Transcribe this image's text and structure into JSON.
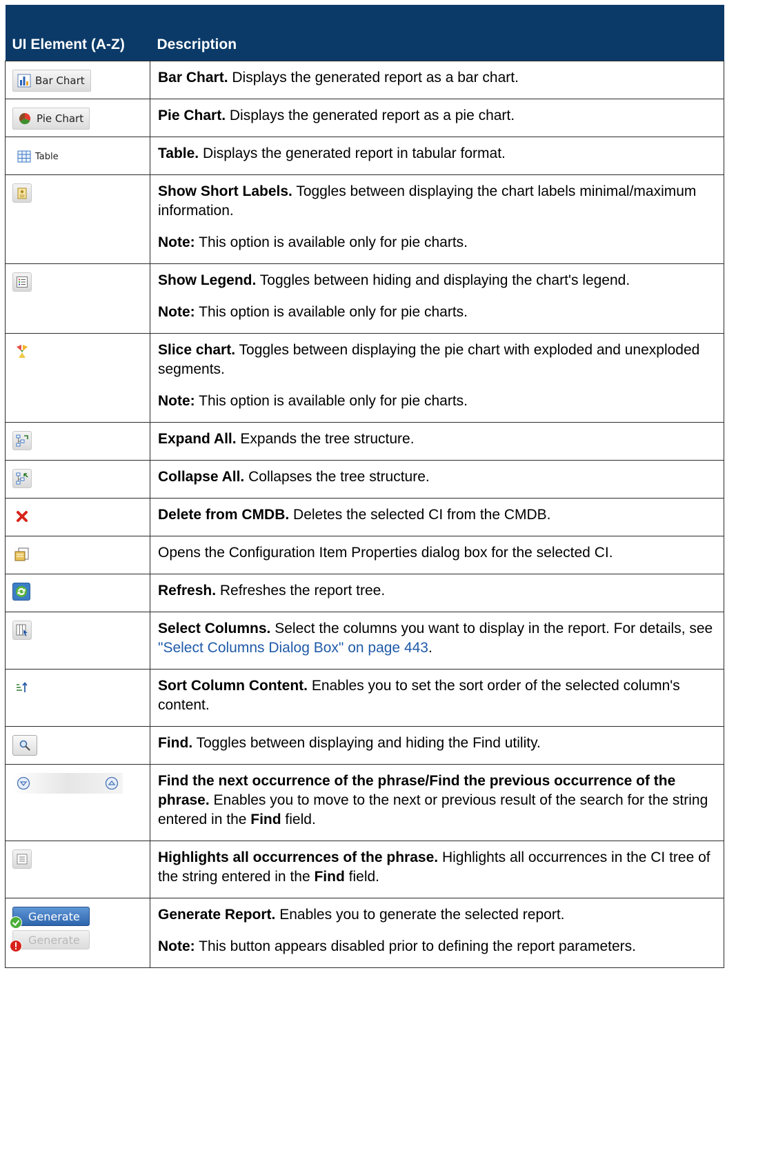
{
  "header": {
    "col1": "UI Element (A-Z)",
    "col2": "Description"
  },
  "icons": {
    "bar_chart_label": "Bar Chart",
    "pie_chart_label": "Pie Chart",
    "table_label": "Table",
    "generate_label": "Generate"
  },
  "rows": [
    {
      "icon": "bar-chart-icon",
      "parts": [
        {
          "bold": "Bar Chart.",
          "text": " Displays the generated report as a bar chart."
        }
      ]
    },
    {
      "icon": "pie-chart-icon",
      "parts": [
        {
          "bold": "Pie Chart.",
          "text": " Displays the generated report as a pie chart."
        }
      ]
    },
    {
      "icon": "table-icon",
      "parts": [
        {
          "bold": "Table.",
          "text": " Displays the generated report in tabular format."
        }
      ]
    },
    {
      "icon": "short-labels-icon",
      "parts": [
        {
          "bold": "Show Short Labels.",
          "text": " Toggles between displaying the chart labels minimal/maximum information."
        },
        {
          "bold": "Note:",
          "text": " This option is available only for pie charts."
        }
      ]
    },
    {
      "icon": "legend-icon",
      "parts": [
        {
          "bold": "Show Legend.",
          "text": " Toggles between hiding and displaying the chart's legend."
        },
        {
          "bold": "Note:",
          "text": " This option is available only for pie charts."
        }
      ]
    },
    {
      "icon": "slice-chart-icon",
      "parts": [
        {
          "bold": "Slice chart.",
          "text": " Toggles between displaying the pie chart with exploded and unexploded segments."
        },
        {
          "bold": "Note:",
          "text": " This option is available only for pie charts."
        }
      ]
    },
    {
      "icon": "expand-all-icon",
      "parts": [
        {
          "bold": "Expand All.",
          "text": " Expands the tree structure."
        }
      ]
    },
    {
      "icon": "collapse-all-icon",
      "parts": [
        {
          "bold": "Collapse All.",
          "text": " Collapses the tree structure."
        }
      ]
    },
    {
      "icon": "delete-icon",
      "parts": [
        {
          "bold": "Delete from CMDB.",
          "text": " Deletes the selected CI from the CMDB."
        }
      ]
    },
    {
      "icon": "properties-icon",
      "parts": [
        {
          "bold": "",
          "text": "Opens the Configuration Item Properties dialog box for the selected CI."
        }
      ]
    },
    {
      "icon": "refresh-icon",
      "parts": [
        {
          "bold": "Refresh.",
          "text": " Refreshes the report tree."
        }
      ]
    },
    {
      "icon": "select-columns-icon",
      "parts": [
        {
          "bold": "Select Columns.",
          "text": " Select the columns you want to display in the report. For details, see ",
          "link": "\"Select Columns Dialog Box\" on page 443",
          "after": "."
        }
      ]
    },
    {
      "icon": "sort-icon",
      "parts": [
        {
          "bold": "Sort Column Content.",
          "text": " Enables you to set the sort order of the selected column's content."
        }
      ]
    },
    {
      "icon": "find-icon",
      "parts": [
        {
          "bold": "Find.",
          "text": " Toggles between displaying and hiding the Find utility."
        }
      ]
    },
    {
      "icon": "find-next-prev-icon",
      "parts": [
        {
          "bold": "Find the next occurrence of the phrase/Find the previous occurrence of the phrase.",
          "text": " Enables you to move to the next or previous result of the search for the string entered in the ",
          "bold2": "Find",
          "after": " field."
        }
      ]
    },
    {
      "icon": "highlight-all-icon",
      "parts": [
        {
          "bold": "Highlights all occurrences of the phrase.",
          "text": " Highlights all occurrences in the CI tree of the string entered in the ",
          "bold2": "Find",
          "after": " field."
        }
      ]
    },
    {
      "icon": "generate-icon",
      "parts": [
        {
          "bold": "Generate Report.",
          "text": " Enables you to generate the selected report."
        },
        {
          "bold": "Note:",
          "text": " This button appears disabled prior to defining the report parameters."
        }
      ]
    }
  ]
}
